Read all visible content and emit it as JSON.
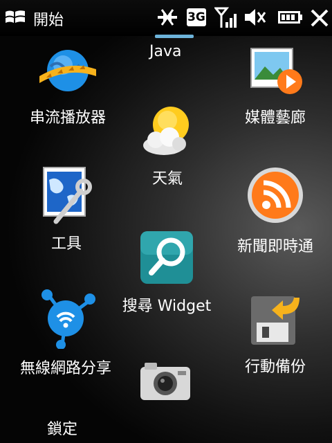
{
  "statusbar": {
    "start_label": "開始",
    "network_type": "3G",
    "icons": [
      "windows-logo-icon",
      "connection-off-icon",
      "3g-icon",
      "signal-icon",
      "volume-muted-icon",
      "battery-icon",
      "close-icon"
    ]
  },
  "tiles": {
    "java": {
      "label": "Java"
    },
    "streaming": {
      "label": "串流播放器"
    },
    "media": {
      "label": "媒體藝廊"
    },
    "weather": {
      "label": "天氣"
    },
    "tools": {
      "label": "工具"
    },
    "news": {
      "label": "新聞即時通"
    },
    "search": {
      "label": "搜尋 Widget"
    },
    "wifi": {
      "label": "無線網路分享"
    },
    "backup": {
      "label": "行動備份"
    },
    "camera": {
      "label": ""
    },
    "lock": {
      "label": "鎖定"
    }
  },
  "colors": {
    "accent": "#ff7a1a",
    "teal": "#1f8f96",
    "blue": "#1e90e6"
  }
}
